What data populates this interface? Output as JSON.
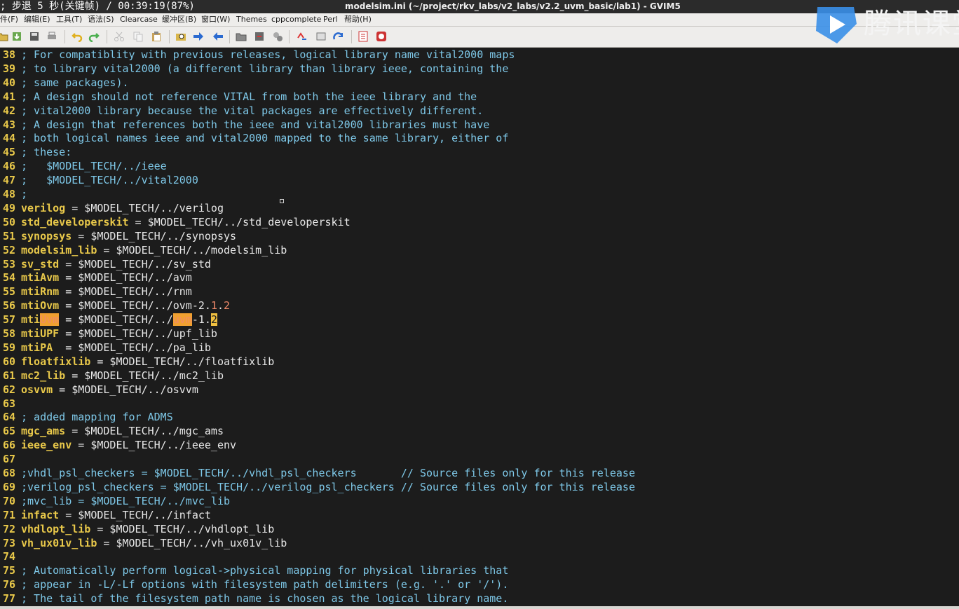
{
  "window": {
    "overlay_text": "; 步退 5 秒(关键帧) / 00:39:19(87%)",
    "title": "modelsim.ini (~/project/rkv_labs/v2_labs/v2.2_uvm_basic/lab1) - GVIM5"
  },
  "watermark": {
    "text": "腾讯课堂"
  },
  "menu": [
    "件(F)",
    "编辑(E)",
    "工具(T)",
    "语法(S)",
    "Clearcase",
    "缓冲区(B)",
    "窗口(W)",
    "Themes",
    "cppcomplete",
    "Perl",
    "帮助(H)"
  ],
  "toolbar_icons": [
    "open-file-icon",
    "save-icon",
    "save-all-icon",
    "print-icon",
    "undo-icon",
    "redo-icon",
    "cut-icon",
    "copy-icon",
    "paste-icon",
    "replace-icon",
    "find-next-icon",
    "find-prev-icon",
    "load-session-icon",
    "save-session-icon",
    "run-script-icon",
    "make-icon",
    "shell-icon",
    "tag-jump-icon",
    "help-icon",
    "find-help-icon"
  ],
  "colors": {
    "background": "#1c1c1c",
    "line_number": "#e8c84a",
    "comment": "#7ec8e8",
    "key": "#e8c84a",
    "number": "#f08a6a",
    "search_highlight": "#f0a030"
  },
  "lines": [
    {
      "n": "38",
      "s": [
        [
          "cmt",
          "; For compatiblity with previous releases, logical library name vital2000 maps"
        ]
      ]
    },
    {
      "n": "39",
      "s": [
        [
          "cmt",
          "; to library vital2000 (a different library than library ieee, containing the"
        ]
      ]
    },
    {
      "n": "40",
      "s": [
        [
          "cmt",
          "; same packages)."
        ]
      ]
    },
    {
      "n": "41",
      "s": [
        [
          "cmt",
          "; A design should not reference VITAL from both the ieee library and the"
        ]
      ]
    },
    {
      "n": "42",
      "s": [
        [
          "cmt",
          "; vital2000 library because the vital packages are effectively different."
        ]
      ]
    },
    {
      "n": "43",
      "s": [
        [
          "cmt",
          "; A design that references both the ieee and vital2000 libraries must have"
        ]
      ]
    },
    {
      "n": "44",
      "s": [
        [
          "cmt",
          "; both logical names ieee and vital2000 mapped to the same library, either of"
        ]
      ]
    },
    {
      "n": "45",
      "s": [
        [
          "cmt",
          "; these:"
        ]
      ]
    },
    {
      "n": "46",
      "s": [
        [
          "cmt",
          ";   $MODEL_TECH/../ieee"
        ]
      ]
    },
    {
      "n": "47",
      "s": [
        [
          "cmt",
          ";   $MODEL_TECH/../vital2000"
        ]
      ]
    },
    {
      "n": "48",
      "s": [
        [
          "cmt",
          ";"
        ]
      ]
    },
    {
      "n": "49",
      "s": [
        [
          "key",
          "verilog"
        ],
        [
          "txt",
          " = $MODEL_TECH/../verilog"
        ]
      ]
    },
    {
      "n": "50",
      "s": [
        [
          "key",
          "std_developerskit"
        ],
        [
          "txt",
          " = $MODEL_TECH/../std_developerskit"
        ]
      ]
    },
    {
      "n": "51",
      "s": [
        [
          "key",
          "synopsys"
        ],
        [
          "txt",
          " = $MODEL_TECH/../synopsys"
        ]
      ]
    },
    {
      "n": "52",
      "s": [
        [
          "key",
          "modelsim_lib"
        ],
        [
          "txt",
          " = $MODEL_TECH/../modelsim_lib"
        ]
      ]
    },
    {
      "n": "53",
      "s": [
        [
          "key",
          "sv_std"
        ],
        [
          "txt",
          " = $MODEL_TECH/../sv_std"
        ]
      ]
    },
    {
      "n": "54",
      "s": [
        [
          "key",
          "mtiAvm"
        ],
        [
          "txt",
          " = $MODEL_TECH/../avm"
        ]
      ]
    },
    {
      "n": "55",
      "s": [
        [
          "key",
          "mtiRnm"
        ],
        [
          "txt",
          " = $MODEL_TECH/../rnm"
        ]
      ]
    },
    {
      "n": "56",
      "s": [
        [
          "key",
          "mtiOvm"
        ],
        [
          "txt",
          " = $MODEL_TECH/../ovm-2."
        ],
        [
          "num",
          "1"
        ],
        [
          "txt",
          "."
        ],
        [
          "num",
          "2"
        ]
      ]
    },
    {
      "n": "57",
      "s": [
        [
          "key",
          "mti"
        ],
        [
          "hl",
          "Uvm"
        ],
        [
          "txt",
          " = $MODEL_TECH/../"
        ],
        [
          "hl",
          "uvm"
        ],
        [
          "txt",
          "-1."
        ],
        [
          "hlc",
          "2"
        ]
      ]
    },
    {
      "n": "58",
      "s": [
        [
          "key",
          "mtiUPF"
        ],
        [
          "txt",
          " = $MODEL_TECH/../upf_lib"
        ]
      ]
    },
    {
      "n": "59",
      "s": [
        [
          "key",
          "mtiPA"
        ],
        [
          "txt",
          "  = $MODEL_TECH/../pa_lib"
        ]
      ]
    },
    {
      "n": "60",
      "s": [
        [
          "key",
          "floatfixlib"
        ],
        [
          "txt",
          " = $MODEL_TECH/../floatfixlib"
        ]
      ]
    },
    {
      "n": "61",
      "s": [
        [
          "key",
          "mc2_lib"
        ],
        [
          "txt",
          " = $MODEL_TECH/../mc2_lib"
        ]
      ]
    },
    {
      "n": "62",
      "s": [
        [
          "key",
          "osvvm"
        ],
        [
          "txt",
          " = $MODEL_TECH/../osvvm"
        ]
      ]
    },
    {
      "n": "63",
      "s": []
    },
    {
      "n": "64",
      "s": [
        [
          "cmt",
          "; added mapping for ADMS"
        ]
      ]
    },
    {
      "n": "65",
      "s": [
        [
          "key",
          "mgc_ams"
        ],
        [
          "txt",
          " = $MODEL_TECH/../mgc_ams"
        ]
      ]
    },
    {
      "n": "66",
      "s": [
        [
          "key",
          "ieee_env"
        ],
        [
          "txt",
          " = $MODEL_TECH/../ieee_env"
        ]
      ]
    },
    {
      "n": "67",
      "s": []
    },
    {
      "n": "68",
      "s": [
        [
          "cmt",
          ";vhdl_psl_checkers = $MODEL_TECH/../vhdl_psl_checkers       // Source files only for this release"
        ]
      ]
    },
    {
      "n": "69",
      "s": [
        [
          "cmt",
          ";verilog_psl_checkers = $MODEL_TECH/../verilog_psl_checkers // Source files only for this release"
        ]
      ]
    },
    {
      "n": "70",
      "s": [
        [
          "cmt",
          ";mvc_lib = $MODEL_TECH/../mvc_lib"
        ]
      ]
    },
    {
      "n": "71",
      "s": [
        [
          "key",
          "infact"
        ],
        [
          "txt",
          " = $MODEL_TECH/../infact"
        ]
      ]
    },
    {
      "n": "72",
      "s": [
        [
          "key",
          "vhdlopt_lib"
        ],
        [
          "txt",
          " = $MODEL_TECH/../vhdlopt_lib"
        ]
      ]
    },
    {
      "n": "73",
      "s": [
        [
          "key",
          "vh_ux01v_lib"
        ],
        [
          "txt",
          " = $MODEL_TECH/../vh_ux01v_lib"
        ]
      ]
    },
    {
      "n": "74",
      "s": []
    },
    {
      "n": "75",
      "s": [
        [
          "cmt",
          "; Automatically perform logical->physical mapping for physical libraries that"
        ]
      ]
    },
    {
      "n": "76",
      "s": [
        [
          "cmt",
          "; appear in -L/-Lf options with filesystem path delimiters (e.g. '.' or '/')."
        ]
      ]
    },
    {
      "n": "77",
      "s": [
        [
          "cmt",
          "; The tail of the filesystem path name is chosen as the logical library name."
        ]
      ]
    }
  ]
}
